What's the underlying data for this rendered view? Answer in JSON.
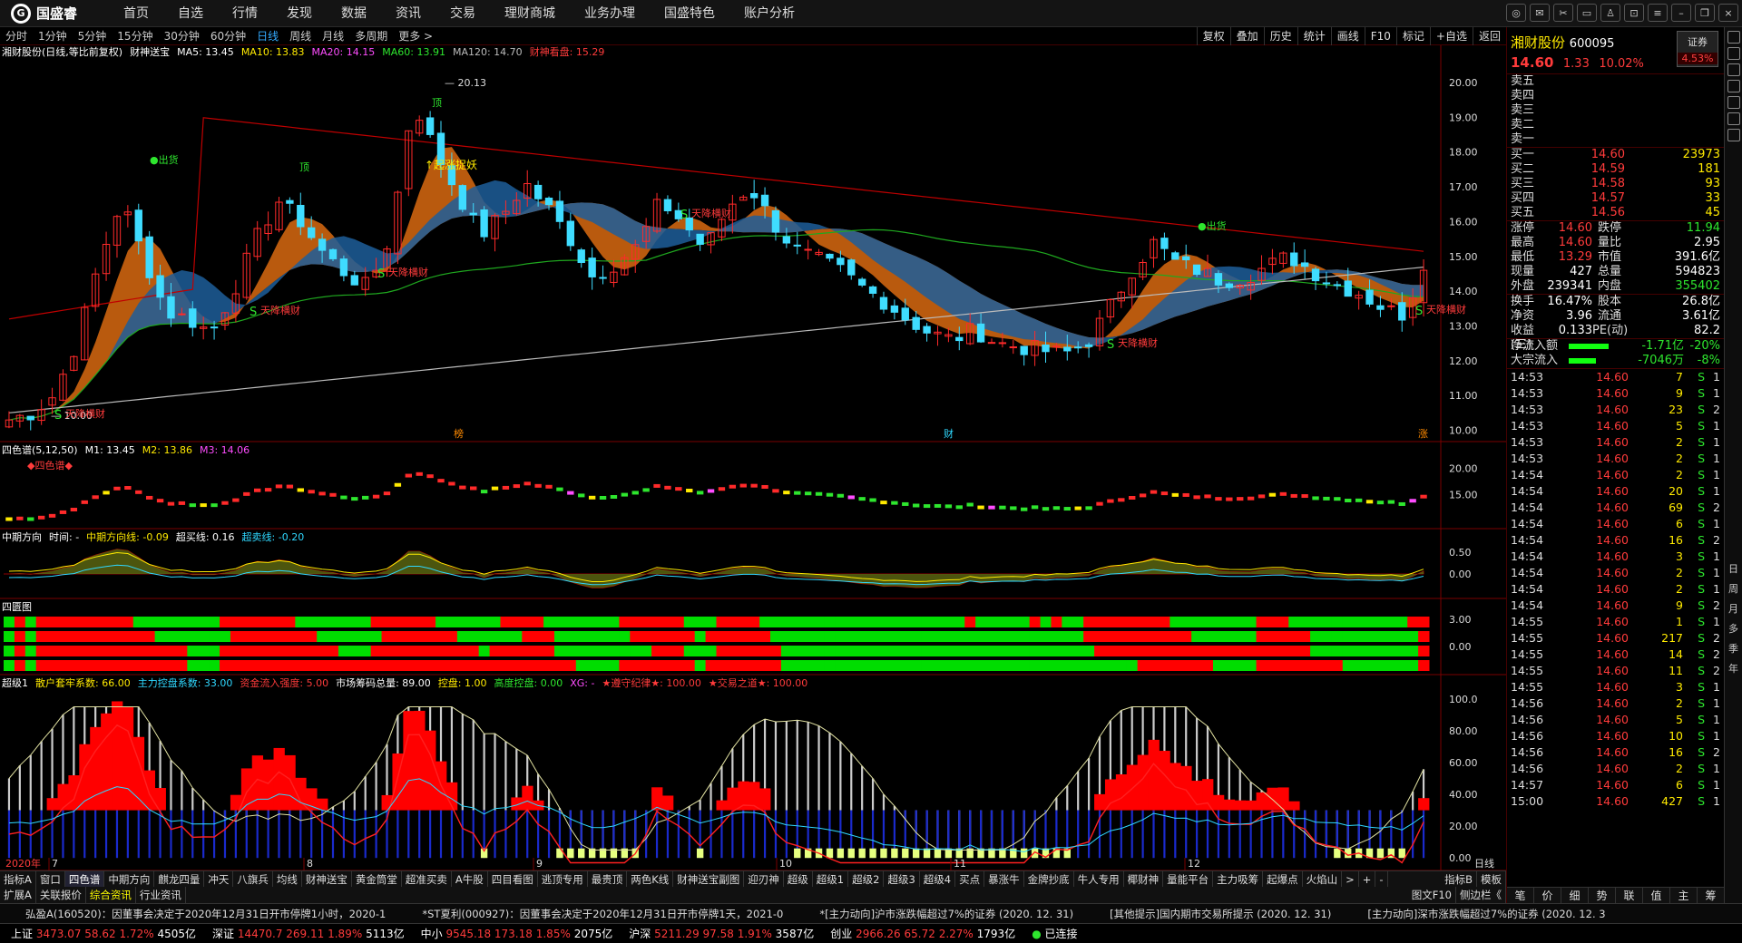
{
  "app": {
    "logo": "国盛睿"
  },
  "nav": [
    "首页",
    "自选",
    "行情",
    "发现",
    "数据",
    "资讯",
    "交易",
    "理财商城",
    "业务办理",
    "国盛特色",
    "账户分析"
  ],
  "periods": [
    "分时",
    "1分钟",
    "5分钟",
    "15分钟",
    "30分钟",
    "60分钟",
    "日线",
    "周线",
    "月线",
    "多周期",
    "更多 >"
  ],
  "period_active": "日线",
  "period_right": [
    "复权",
    "叠加",
    "历史",
    "统计",
    "画线",
    "F10",
    "标记",
    "+自选",
    "返回"
  ],
  "main_header": {
    "stock": "湘财股份(日线,等比前复权)",
    "indicator": "财神送宝",
    "ma5": "MA5: 13.45",
    "ma10": "MA10: 13.83",
    "ma20": "MA20: 14.15",
    "ma60": "MA60: 13.91",
    "ma120": "MA120: 14.70",
    "caishen": "财神看盘: 15.29"
  },
  "main_yaxis": [
    "20.00",
    "19.00",
    "18.00",
    "17.00",
    "16.00",
    "15.00",
    "14.00",
    "13.00",
    "12.00",
    "11.00",
    "10.00"
  ],
  "annotations": {
    "chuhuo": "出货",
    "ding": "顶",
    "xiang": "天降横财",
    "qizhang": "起涨捉妖",
    "high": "20.13",
    "low": "10.00",
    "S": "S",
    "marks": [
      "榜",
      "财",
      "涨"
    ]
  },
  "sub1": {
    "name": "四色谱(5,12,50)",
    "m1": "M1: 13.45",
    "m2": "M2: 13.86",
    "m3": "M3: 14.06",
    "title": "◆四色谱◆",
    "yaxis": [
      "20.00",
      "15.00"
    ]
  },
  "sub2": {
    "name": "中期方向",
    "time": "时间: -",
    "zq": "中期方向线: -0.09",
    "cm": "超买线: 0.16",
    "cs": "超卖线: -0.20",
    "yaxis": [
      "0.50",
      "0.00"
    ]
  },
  "sub3": {
    "name": "四匮图",
    "yaxis": [
      "3.00",
      "0.00"
    ]
  },
  "sub4": {
    "name": "超级1",
    "sh": "散户套牢系数: 66.00",
    "zl": "主力控盘系数: 33.00",
    "zj": "资金流入强度: 5.00",
    "sc": "市场筹码总量: 89.00",
    "kp": "控盘: 1.00",
    "gd": "高度控盘: 0.00",
    "xg": "XG: -",
    "zs": "★遵守纪律★: 100.00",
    "jy": "★交易之道★: 100.00",
    "yaxis": [
      "100.0",
      "80.00",
      "60.00",
      "40.00",
      "20.00",
      "0.00"
    ]
  },
  "xaxis": {
    "start": "2020年",
    "labels": [
      "7",
      "8",
      "9",
      "10",
      "11",
      "12"
    ],
    "right": "日线"
  },
  "tabs1": [
    "指标A",
    "窗口",
    "四色谱",
    "中期方向",
    "麒龙四量",
    "冲天",
    "八旗兵",
    "均线",
    "财神送宝",
    "黄金筒堂",
    "超准买卖",
    "A牛股",
    "四目看图",
    "逃顶专用",
    "最贵顶",
    "两色K线",
    "财神送宝副图",
    "迎刃神",
    "超级",
    "超级1",
    "超级2",
    "超级3",
    "超级4",
    "买点",
    "暴涨牛",
    "金牌抄底",
    "牛人专用",
    "椰财神",
    "量能平台",
    "主力吸筹",
    "起爆点",
    "火焰山",
    ">",
    "+",
    "-"
  ],
  "tabs1_active": "四色谱",
  "tabs1_right": [
    "指标B",
    "模板"
  ],
  "tabs2": [
    "扩展A",
    "关联报价",
    "综合资讯",
    "行业资讯"
  ],
  "tabs2_active": "综合资讯",
  "tabs2_right": [
    "图文F10",
    "侧边栏《"
  ],
  "ticker": [
    "弘盈A(160520)：因董事会决定于2020年12月31日开市停牌1小时，2020-1",
    "*ST夏利(000927)：因董事会决定于2020年12月31日开市停牌1天，2021-0",
    "*[主力动向]沪市涨跌幅超过7%的证券 (2020. 12. 31)",
    "[其他提示]国内期市交易所提示 (2020. 12. 31)",
    "[主力动向]深市涨跌幅超过7%的证券 (2020. 12. 3"
  ],
  "status": {
    "sh": "上证",
    "sh_v": "3473.07",
    "sh_c": "58.62",
    "sh_p": "1.72%",
    "sh_a": "4505亿",
    "sz": "深证",
    "sz_v": "14470.7",
    "sz_c": "269.11",
    "sz_p": "1.89%",
    "sz_a": "5113亿",
    "zx": "中小",
    "zx_v": "9545.18",
    "zx_c": "173.18",
    "zx_p": "1.85%",
    "zx_a": "2075亿",
    "hs": "沪深",
    "hs_v": "5211.29",
    "hs_c": "97.58",
    "hs_p": "1.91%",
    "hs_a": "3587亿",
    "cy": "创业",
    "cy_v": "2966.26",
    "cy_c": "65.72",
    "cy_p": "2.27%",
    "cy_a": "1793亿",
    "conn": "已连接"
  },
  "quote": {
    "name": "湘财股份",
    "code": "600095",
    "badge": "证券",
    "badge_pct": "4.53%",
    "price": "14.60",
    "chg": "1.33",
    "pct": "10.02%",
    "sell": [
      "卖五",
      "卖四",
      "卖三",
      "卖二",
      "卖一"
    ],
    "buy": [
      [
        "买一",
        "14.60",
        "23973"
      ],
      [
        "买二",
        "14.59",
        "181"
      ],
      [
        "买三",
        "14.58",
        "93"
      ],
      [
        "买四",
        "14.57",
        "33"
      ],
      [
        "买五",
        "14.56",
        "45"
      ]
    ],
    "stats": [
      [
        "涨停",
        "14.60",
        "跌停",
        "11.94"
      ],
      [
        "最高",
        "14.60",
        "量比",
        "2.95"
      ],
      [
        "最低",
        "13.29",
        "市值",
        "391.6亿"
      ],
      [
        "现量",
        "427",
        "总量",
        "594823"
      ],
      [
        "外盘",
        "239341",
        "内盘",
        "355402"
      ]
    ],
    "stats2": [
      [
        "换手",
        "16.47%",
        "股本",
        "26.8亿"
      ],
      [
        "净资",
        "3.96",
        "流通",
        "3.61亿"
      ],
      [
        "收益(三)",
        "0.133",
        "PE(动)",
        "82.2"
      ]
    ],
    "flow": [
      [
        "净流入额",
        "-1.71亿",
        "-20%"
      ],
      [
        "大宗流入",
        "-7046万",
        "-8%"
      ]
    ],
    "ticks": [
      [
        "14:53",
        "14.60",
        "7",
        "S",
        "1"
      ],
      [
        "14:53",
        "14.60",
        "9",
        "S",
        "1"
      ],
      [
        "14:53",
        "14.60",
        "23",
        "S",
        "2"
      ],
      [
        "14:53",
        "14.60",
        "5",
        "S",
        "1"
      ],
      [
        "14:53",
        "14.60",
        "2",
        "S",
        "1"
      ],
      [
        "14:53",
        "14.60",
        "2",
        "S",
        "1"
      ],
      [
        "14:54",
        "14.60",
        "2",
        "S",
        "1"
      ],
      [
        "14:54",
        "14.60",
        "20",
        "S",
        "1"
      ],
      [
        "14:54",
        "14.60",
        "69",
        "S",
        "2"
      ],
      [
        "14:54",
        "14.60",
        "6",
        "S",
        "1"
      ],
      [
        "14:54",
        "14.60",
        "16",
        "S",
        "2"
      ],
      [
        "14:54",
        "14.60",
        "3",
        "S",
        "1"
      ],
      [
        "14:54",
        "14.60",
        "2",
        "S",
        "1"
      ],
      [
        "14:54",
        "14.60",
        "2",
        "S",
        "1"
      ],
      [
        "14:54",
        "14.60",
        "9",
        "S",
        "2"
      ],
      [
        "14:55",
        "14.60",
        "1",
        "S",
        "1"
      ],
      [
        "14:55",
        "14.60",
        "217",
        "S",
        "2"
      ],
      [
        "14:55",
        "14.60",
        "14",
        "S",
        "2"
      ],
      [
        "14:55",
        "14.60",
        "11",
        "S",
        "2"
      ],
      [
        "14:55",
        "14.60",
        "3",
        "S",
        "1"
      ],
      [
        "14:56",
        "14.60",
        "2",
        "S",
        "1"
      ],
      [
        "14:56",
        "14.60",
        "5",
        "S",
        "1"
      ],
      [
        "14:56",
        "14.60",
        "10",
        "S",
        "1"
      ],
      [
        "14:56",
        "14.60",
        "16",
        "S",
        "2"
      ],
      [
        "14:56",
        "14.60",
        "2",
        "S",
        "1"
      ],
      [
        "14:57",
        "14.60",
        "6",
        "S",
        "1"
      ],
      [
        "15:00",
        "14.60",
        "427",
        "S",
        "1"
      ]
    ],
    "bottom_tabs": [
      "笔",
      "价",
      "细",
      "势",
      "联",
      "值",
      "主",
      "筹"
    ]
  },
  "sidebar": [
    "日",
    "周",
    "月",
    "多",
    "季",
    "年"
  ],
  "colors": {
    "up": "#ff3b3b",
    "down": "#2fd8ff",
    "ma": "#ffffff"
  }
}
